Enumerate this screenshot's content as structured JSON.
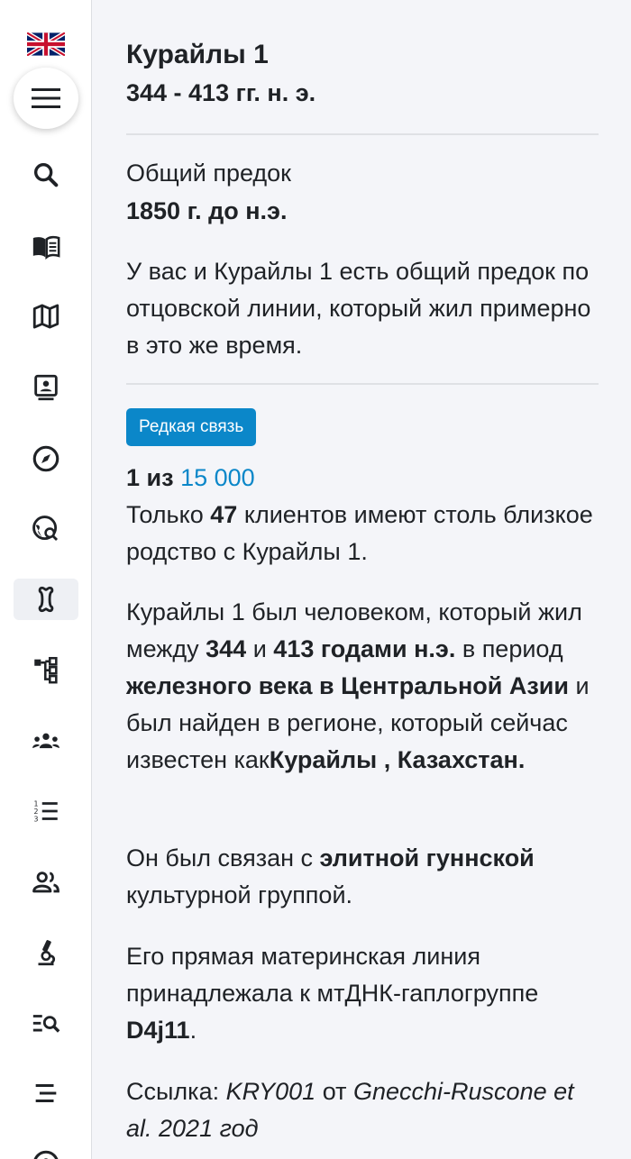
{
  "sidebar": {
    "language_flag": "uk-flag-icon",
    "items": [
      {
        "name": "search-icon"
      },
      {
        "name": "book-icon"
      },
      {
        "name": "map-icon"
      },
      {
        "name": "profile-card-icon"
      },
      {
        "name": "compass-icon"
      },
      {
        "name": "globe-search-icon"
      },
      {
        "name": "bone-icon"
      },
      {
        "name": "tree-icon"
      },
      {
        "name": "group-icon"
      },
      {
        "name": "numbered-list-icon"
      },
      {
        "name": "users-icon"
      },
      {
        "name": "microscope-icon"
      },
      {
        "name": "list-search-icon"
      },
      {
        "name": "sort-lines-icon"
      }
    ],
    "active_item": "bone-icon"
  },
  "header": {
    "title": "Курайлы 1",
    "subtitle": "344 - 413 гг. н. э."
  },
  "ancestor": {
    "label": "Общий предок",
    "value": "1850 г. до н.э.",
    "description": "У вас и Курайлы 1 есть общий предок по отцовской линии, который жил примерно в это же время."
  },
  "rarity": {
    "badge": "Редкая связь",
    "ratio_prefix": "1 из",
    "ratio_value": "15 000",
    "clients_prefix": "Только",
    "clients_count": "47",
    "clients_suffix": "клиентов имеют столь близкое родство с Курайлы 1."
  },
  "bio": {
    "p1_a": "Курайлы 1 был человеком, который жил между",
    "year_start": "344",
    "and": "и",
    "year_end": "413 годами н.э.",
    "p1_b": "в период",
    "era": "железного века в Центральной Азии",
    "p1_c": "и был найден в регионе, который сейчас известен как",
    "location": "Курайлы , Казахстан.",
    "p2_a": "Он был связан с",
    "culture": "элитной гуннской",
    "p2_b": "культурной группой.",
    "p3_a": "Его прямая материнская линия принадлежала к мтДНК-гаплогруппе",
    "haplogroup": "D4j11",
    "p3_b": ".",
    "ref_prefix": "Ссылка:",
    "ref_id": "KRY001",
    "ref_mid": "от",
    "ref_authors": "Gnecchi-Ruscone et al. 2021 год"
  },
  "colors": {
    "accent": "#0b87c9",
    "background": "#f4f5f9",
    "sidebar": "#ffffff"
  }
}
